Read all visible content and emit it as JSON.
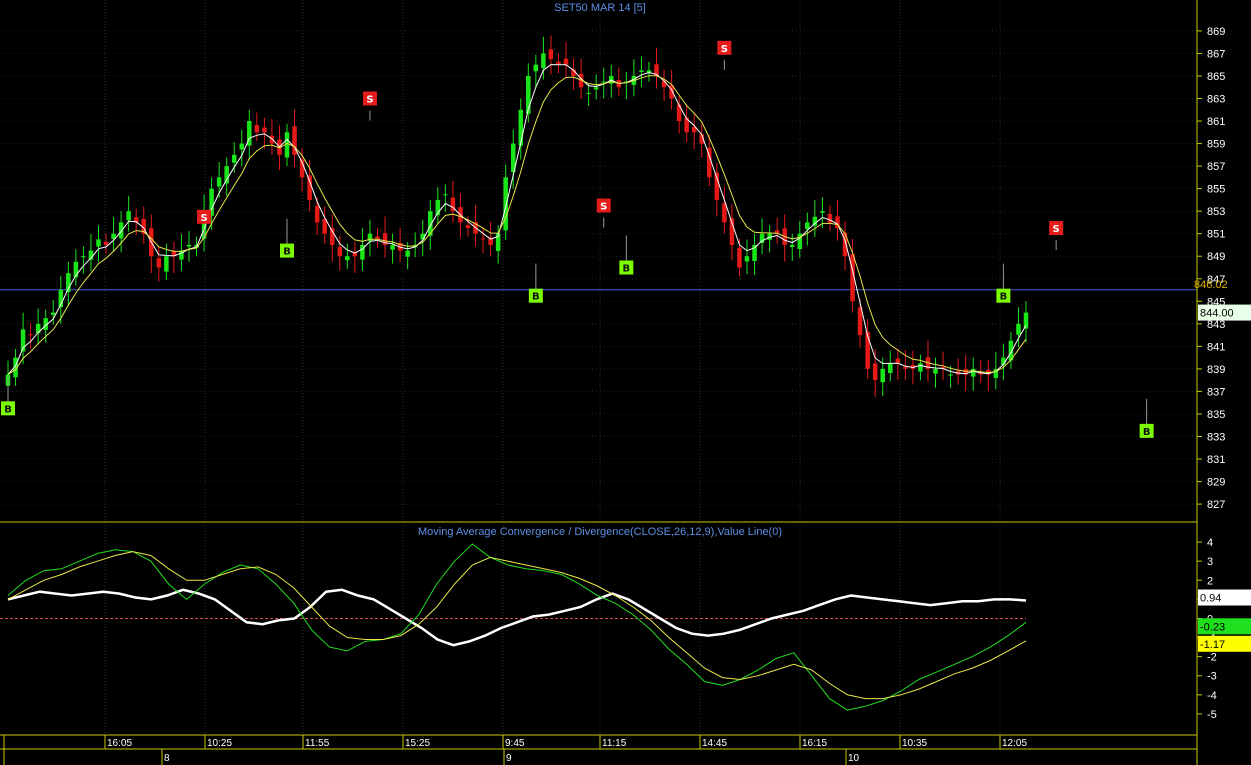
{
  "chart_data": [
    {
      "type": "candlestick",
      "title": "SET50 MAR 14  [5]",
      "y_ticks": [
        869,
        867,
        865,
        863,
        861,
        859,
        857,
        855,
        853,
        851,
        849,
        847,
        845,
        843,
        841,
        839,
        837,
        835,
        833,
        831,
        829,
        827
      ],
      "ylim": [
        825.5,
        870.5
      ],
      "x_ticks": [
        "16:05",
        "10:25",
        "11:55",
        "15:25",
        "9:45",
        "11:15",
        "14:45",
        "16:15",
        "10:35",
        "12:05"
      ],
      "day_labels": [
        "8",
        "9",
        "10"
      ],
      "last_price": "844.00",
      "hline": {
        "value": 846.02,
        "label": "846.02"
      },
      "closes": [
        838.5,
        840,
        842.5,
        842,
        843,
        843.5,
        844,
        846,
        847.5,
        848.5,
        849,
        849.5,
        850.5,
        850,
        851,
        852,
        853,
        852,
        851,
        849,
        848,
        849,
        849,
        849.5,
        850,
        850,
        853,
        855,
        856,
        857,
        858,
        859,
        861,
        860,
        860,
        859,
        858,
        860,
        858,
        856,
        854,
        852,
        851,
        850,
        849,
        849,
        849,
        850,
        851,
        850.5,
        850,
        850,
        849.5,
        849.5,
        850,
        851,
        853,
        854,
        854.5,
        853,
        852,
        851.5,
        851,
        850.5,
        850,
        851,
        856,
        859,
        862,
        865,
        866,
        867,
        866.5,
        866,
        866,
        865,
        864,
        863.5,
        864,
        864.5,
        865,
        864,
        864.5,
        865,
        865.5,
        865.5,
        865,
        864,
        863,
        861,
        860,
        860,
        859,
        856,
        854,
        852,
        850,
        848,
        849,
        850,
        851,
        851,
        851,
        850,
        850,
        851,
        852,
        852.5,
        853,
        852,
        851.5,
        849,
        845,
        842,
        839,
        838,
        839,
        839.5,
        839.5,
        839,
        839,
        839.5,
        839,
        839,
        839,
        838.5,
        838.5,
        838.5,
        839,
        838.5,
        838.5,
        839,
        840,
        841.5,
        843,
        844
      ],
      "signals": [
        {
          "label": "B",
          "i": 0,
          "price": 835.5,
          "dir": "buy"
        },
        {
          "label": "S",
          "i": 26,
          "price": 852.5,
          "dir": "sell"
        },
        {
          "label": "B",
          "i": 37,
          "price": 849.5,
          "dir": "buy"
        },
        {
          "label": "S",
          "i": 48,
          "price": 863,
          "dir": "sell"
        },
        {
          "label": "B",
          "i": 70,
          "price": 845.5,
          "dir": "buy"
        },
        {
          "label": "S",
          "i": 79,
          "price": 853.5,
          "dir": "sell"
        },
        {
          "label": "B",
          "i": 82,
          "price": 848,
          "dir": "buy"
        },
        {
          "label": "S",
          "i": 95,
          "price": 867.5,
          "dir": "sell"
        },
        {
          "label": "B",
          "i": 132,
          "price": 845.5,
          "dir": "buy"
        },
        {
          "label": "S",
          "i": 139,
          "price": 851.5,
          "dir": "sell"
        },
        {
          "label": "B",
          "i": 151,
          "price": 833.5,
          "dir": "buy"
        }
      ]
    },
    {
      "type": "line",
      "title": "Moving Average Convergence / Divergence(CLOSE,26,12,9),Value Line(0)",
      "y_ticks": [
        4,
        3,
        2,
        1,
        0,
        -1,
        -2,
        -3,
        -4,
        -5
      ],
      "ylim": [
        -6,
        5
      ],
      "series": [
        {
          "color": "#ffffff",
          "last_label": "0.94",
          "values": [
            1,
            1.2,
            1.4,
            1.3,
            1.2,
            1.3,
            1.4,
            1.3,
            1.1,
            1.0,
            1.2,
            1.5,
            1.3,
            1.0,
            0.4,
            -0.2,
            -0.3,
            -0.1,
            0.0,
            0.6,
            1.4,
            1.5,
            1.2,
            1.0,
            0.5,
            0.0,
            -0.5,
            -1.1,
            -1.4,
            -1.2,
            -0.9,
            -0.5,
            -0.2,
            0.1,
            0.2,
            0.4,
            0.6,
            1.0,
            1.3,
            1.0,
            0.5,
            0.0,
            -0.5,
            -0.8,
            -0.9,
            -0.8,
            -0.6,
            -0.3,
            0.0,
            0.2,
            0.4,
            0.7,
            1.0,
            1.2,
            1.1,
            1.0,
            0.9,
            0.8,
            0.7,
            0.8,
            0.9,
            0.9,
            1.0,
            1.0,
            0.94
          ]
        },
        {
          "color": "#22dd22",
          "last_label": "-0.23",
          "values": [
            1.2,
            2.0,
            2.5,
            2.6,
            3.0,
            3.4,
            3.6,
            3.5,
            3.0,
            1.8,
            1.0,
            1.8,
            2.4,
            2.8,
            2.6,
            1.8,
            0.8,
            -0.6,
            -1.5,
            -1.7,
            -1.2,
            -1.1,
            -0.8,
            0.2,
            1.8,
            3.0,
            3.9,
            3.2,
            2.8,
            2.6,
            2.5,
            2.3,
            1.8,
            1.2,
            0.8,
            0.2,
            -0.6,
            -1.6,
            -2.4,
            -3.3,
            -3.5,
            -3.2,
            -2.7,
            -2.1,
            -1.8,
            -3.0,
            -4.2,
            -4.8,
            -4.6,
            -4.3,
            -3.8,
            -3.2,
            -2.8,
            -2.4,
            -2.0,
            -1.5,
            -0.9,
            -0.2
          ]
        },
        {
          "color": "#e8e84a",
          "last_label": "-1.17",
          "values": [
            1.0,
            1.5,
            2.0,
            2.3,
            2.7,
            3.0,
            3.3,
            3.5,
            3.3,
            2.6,
            2.0,
            2.0,
            2.3,
            2.6,
            2.7,
            2.3,
            1.6,
            0.6,
            -0.4,
            -1.0,
            -1.1,
            -1.1,
            -0.9,
            -0.3,
            0.6,
            1.8,
            2.8,
            3.2,
            3.0,
            2.8,
            2.6,
            2.4,
            2.1,
            1.7,
            1.2,
            0.6,
            -0.1,
            -1.0,
            -1.8,
            -2.6,
            -3.1,
            -3.2,
            -3.0,
            -2.7,
            -2.4,
            -2.7,
            -3.4,
            -4.0,
            -4.2,
            -4.2,
            -4.0,
            -3.7,
            -3.3,
            -2.9,
            -2.6,
            -2.2,
            -1.7,
            -1.17
          ]
        }
      ]
    }
  ]
}
